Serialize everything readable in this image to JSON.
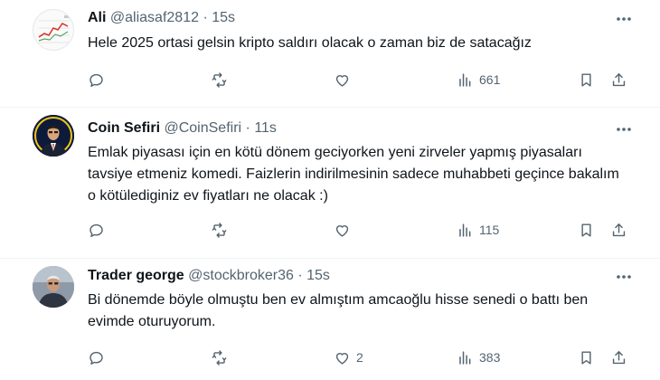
{
  "tweets": [
    {
      "name": "Ali",
      "handle": "@aliasaf2812",
      "separator": "·",
      "time": "15s",
      "text": "Hele 2025 ortasi gelsin kripto saldırı olacak o zaman biz de satacağız",
      "likes": "",
      "views": "661"
    },
    {
      "name": "Coin Sefiri",
      "handle": "@CoinSefiri",
      "separator": "·",
      "time": "11s",
      "text": "Emlak piyasası için en kötü dönem geciyorken yeni zirveler yapmış piyasaları tavsiye etmeniz komedi. Faizlerin indirilmesinin sadece muhabbeti geçince bakalım o kötülediginiz ev fiyatları ne olacak :)",
      "likes": "",
      "views": "115"
    },
    {
      "name": "Trader george",
      "handle": "@stockbroker36",
      "separator": "·",
      "time": "15s",
      "text": "Bi dönemde böyle olmuştu ben ev almıştım amcaoğlu hisse senedi o battı ben evimde oturuyorum.",
      "likes": "2",
      "views": "383"
    }
  ],
  "icons": {
    "more": "more-dots-icon",
    "reply": "reply-icon",
    "retweet": "retweet-icon",
    "like": "heart-icon",
    "views": "views-chart-icon",
    "bookmark": "bookmark-icon",
    "share": "share-icon"
  },
  "colors": {
    "text": "#0f1419",
    "secondary": "#536471",
    "divider": "#eff3f4"
  }
}
